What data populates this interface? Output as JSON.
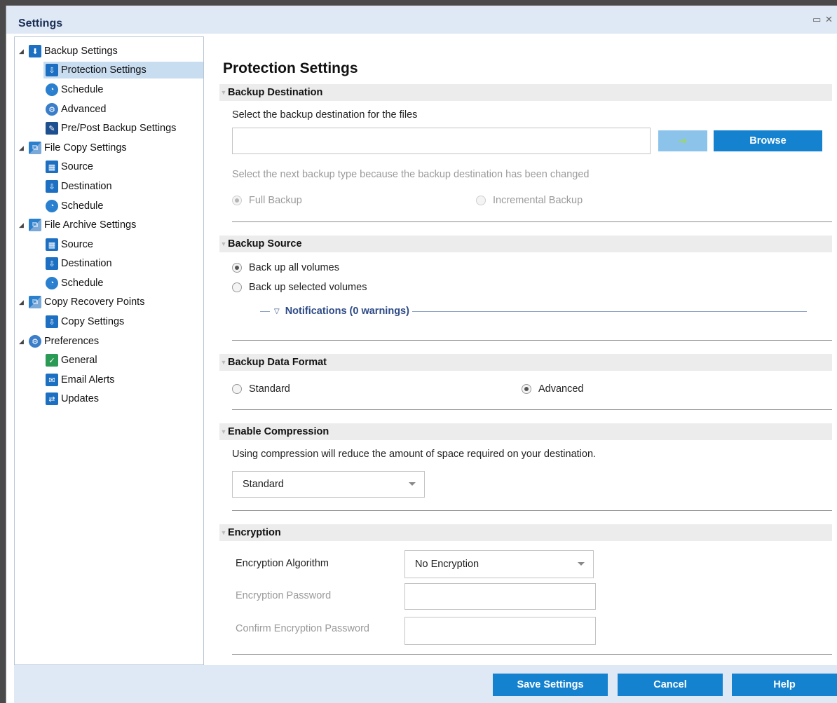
{
  "window": {
    "title": "Settings",
    "restore_icon": "restore-icon",
    "close_icon": "close-icon"
  },
  "sidebar": {
    "items": [
      {
        "label": "Backup Settings",
        "icon": "backup-icon",
        "level": 0
      },
      {
        "label": "Protection Settings",
        "icon": "destination-icon",
        "level": 1,
        "selected": true
      },
      {
        "label": "Schedule",
        "icon": "schedule-icon",
        "level": 1
      },
      {
        "label": "Advanced",
        "icon": "advanced-icon",
        "level": 1
      },
      {
        "label": "Pre/Post Backup Settings",
        "icon": "wrench-icon",
        "level": 1
      },
      {
        "label": "File Copy Settings",
        "icon": "file-copy-icon",
        "level": 0
      },
      {
        "label": "Source",
        "icon": "source-icon",
        "level": 1
      },
      {
        "label": "Destination",
        "icon": "destination-icon",
        "level": 1
      },
      {
        "label": "Schedule",
        "icon": "schedule-icon",
        "level": 1
      },
      {
        "label": "File Archive Settings",
        "icon": "file-archive-icon",
        "level": 0
      },
      {
        "label": "Source",
        "icon": "source-icon",
        "level": 1
      },
      {
        "label": "Destination",
        "icon": "destination-icon",
        "level": 1
      },
      {
        "label": "Schedule",
        "icon": "schedule-icon",
        "level": 1
      },
      {
        "label": "Copy Recovery Points",
        "icon": "copy-recovery-icon",
        "level": 0
      },
      {
        "label": "Copy Settings",
        "icon": "destination-icon",
        "level": 1
      },
      {
        "label": "Preferences",
        "icon": "preferences-icon",
        "level": 0
      },
      {
        "label": "General",
        "icon": "general-icon",
        "level": 1
      },
      {
        "label": "Email Alerts",
        "icon": "email-icon",
        "level": 1
      },
      {
        "label": "Updates",
        "icon": "updates-icon",
        "level": 1
      }
    ]
  },
  "main": {
    "title": "Protection Settings",
    "backup_destination": {
      "heading": "Backup Destination",
      "prompt": "Select the backup destination for the files",
      "path_value": "",
      "go_icon": "arrow-right-icon",
      "browse_label": "Browse",
      "changed_notice": "Select the next backup type because the backup destination has been changed",
      "full_backup_label": "Full Backup",
      "incremental_backup_label": "Incremental Backup",
      "selected_type": "full"
    },
    "backup_source": {
      "heading": "Backup Source",
      "all_volumes_label": "Back up all volumes",
      "selected_volumes_label": "Back up selected volumes",
      "selected": "all",
      "notifications_label": "Notifications (0 warnings)"
    },
    "backup_data_format": {
      "heading": "Backup Data Format",
      "standard_label": "Standard",
      "advanced_label": "Advanced",
      "selected": "advanced"
    },
    "compression": {
      "heading": "Enable Compression",
      "description": "Using compression will reduce the amount of space required on your destination.",
      "selected_value": "Standard"
    },
    "encryption": {
      "heading": "Encryption",
      "algorithm_label": "Encryption Algorithm",
      "algorithm_value": "No Encryption",
      "password_label": "Encryption Password",
      "password_value": "",
      "confirm_label": "Confirm Encryption Password",
      "confirm_value": ""
    }
  },
  "footer": {
    "save_label": "Save Settings",
    "cancel_label": "Cancel",
    "help_label": "Help"
  },
  "colors": {
    "accent": "#1582d0",
    "header_bg": "#dfe8f5",
    "selected_bg": "#c9ddf1"
  }
}
